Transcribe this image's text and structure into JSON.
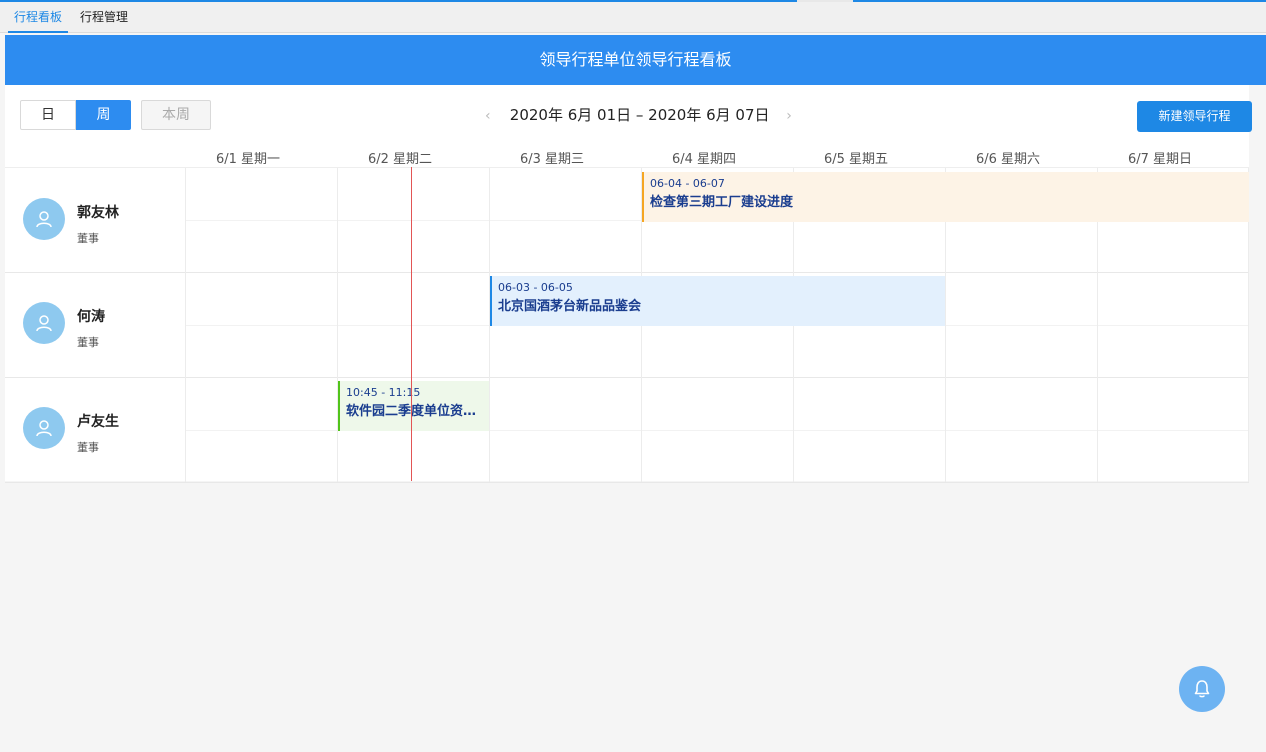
{
  "tabs": [
    {
      "label": "行程看板",
      "active": true
    },
    {
      "label": "行程管理",
      "active": false
    }
  ],
  "banner": {
    "title": "领导行程单位领导行程看板"
  },
  "toolbar": {
    "view_day": "日",
    "view_week": "周",
    "this_week": "本周",
    "range": "2020年 6月 01日 – 2020年 6月 07日",
    "new_button": "新建领导行程"
  },
  "days": [
    "6/1 星期一",
    "6/2 星期二",
    "6/3 星期三",
    "6/4 星期四",
    "6/5 星期五",
    "6/6 星期六",
    "6/7 星期日"
  ],
  "people": [
    {
      "name": "郭友林",
      "role": "董事"
    },
    {
      "name": "何涛",
      "role": "董事"
    },
    {
      "name": "卢友生",
      "role": "董事"
    }
  ],
  "events": [
    {
      "time": "06-04 - 06-07",
      "title": "检查第三期工厂建设进度",
      "color": "#f5a623"
    },
    {
      "time": "06-03 - 06-05",
      "title": "北京国酒茅台新品品鉴会",
      "color": "#1e88e5"
    },
    {
      "time": "10:45 - 11:15",
      "title": "软件园二季度单位资…",
      "color": "#52c41a"
    }
  ],
  "colors": {
    "primary": "#1e88e5",
    "banner": "#2d8cf0",
    "now_line": "#e25555"
  }
}
